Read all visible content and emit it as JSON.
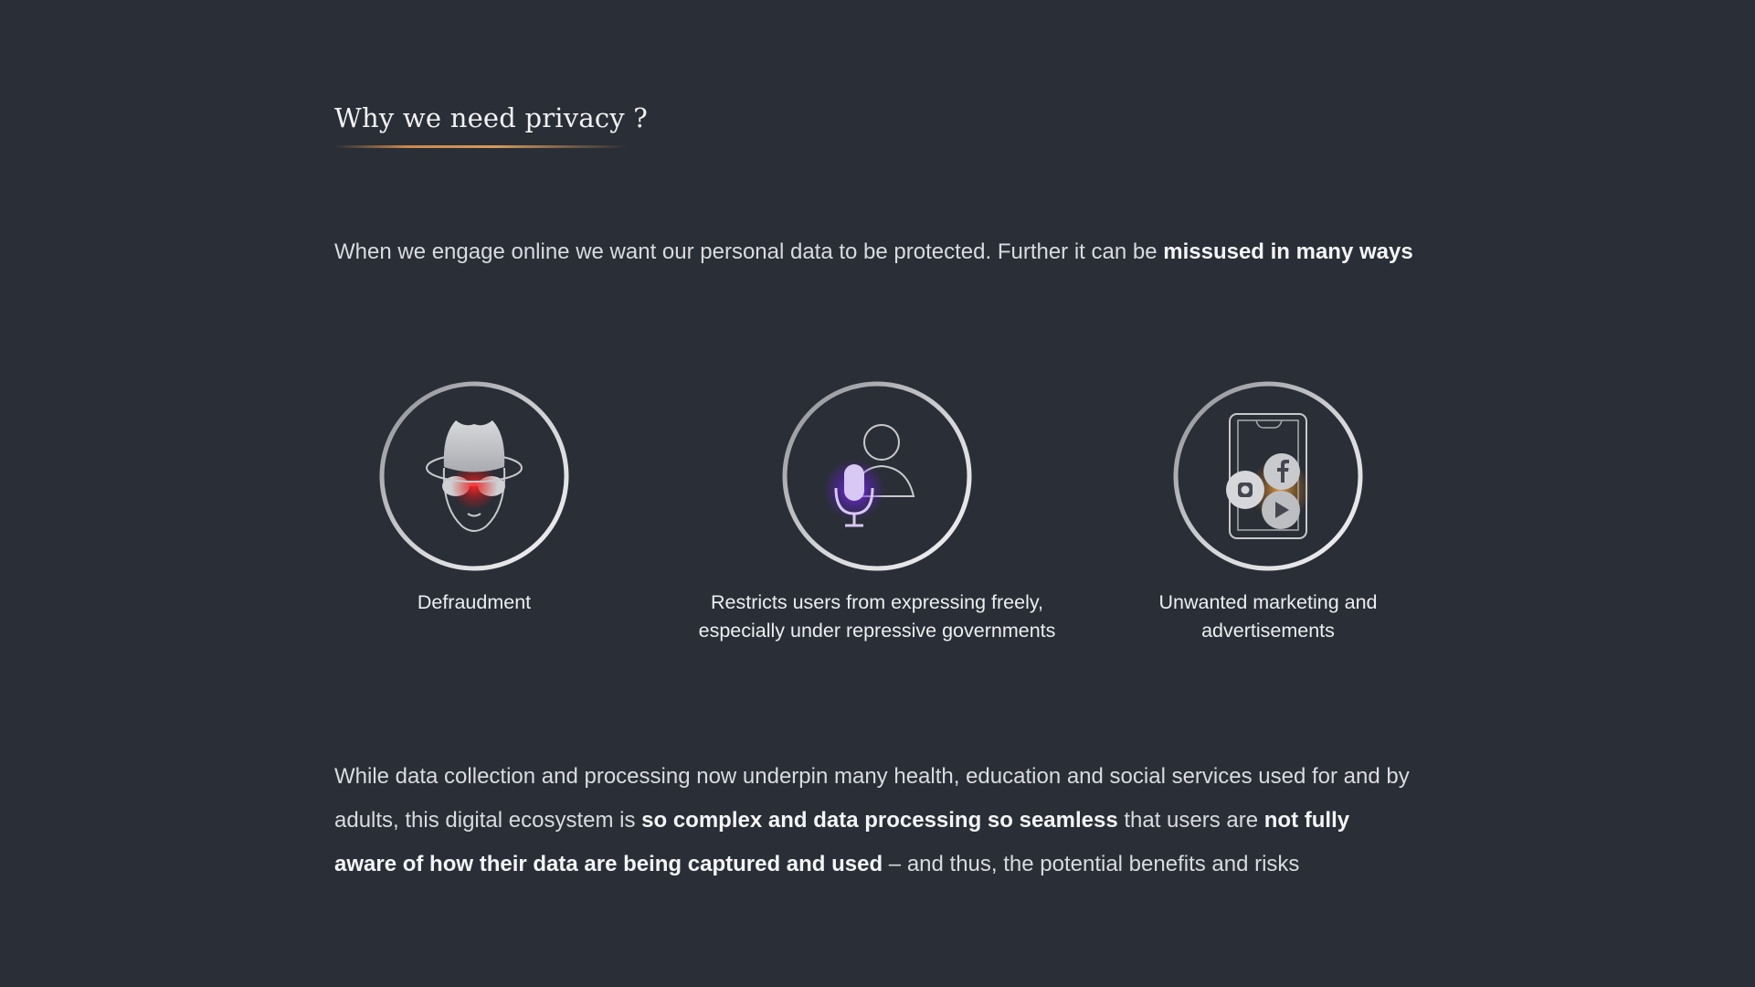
{
  "slide": {
    "title": "Why we need privacy ?",
    "intro": {
      "text": "When we engage online we want our personal data to be protected. Further it can be ",
      "emphasis": "missused in many ways"
    },
    "cards": [
      {
        "icon": "spy-icon",
        "label": "Defraudment"
      },
      {
        "icon": "user-microphone-icon",
        "label_line1": "Restricts users from expressing freely,",
        "label_line2": "especially under repressive governments"
      },
      {
        "icon": "smartphone-social-media-icon",
        "label_line1": "Unwanted marketing and",
        "label_line2": "advertisements"
      }
    ],
    "outro": {
      "part1": "While data collection and processing now underpin many health, education and social services used for and by adults, this digital ecosystem is ",
      "bold1": "so complex and data processing so seamless",
      "part2": " that users are ",
      "bold2": "not fully aware of how their data are being captured and used",
      "part3": " – and thus, the potential benefits and risks"
    }
  },
  "colors": {
    "background": "#2a2e36",
    "accent_underline": "#c9894e",
    "spy_glow": "#ff2a2a",
    "mic_glow": "#7b2cff",
    "phone_glow": "#f0a040"
  }
}
